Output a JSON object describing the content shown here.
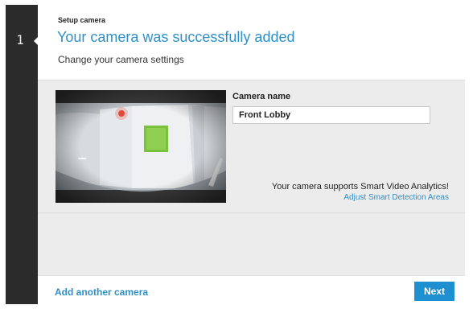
{
  "stepper": {
    "number": "1"
  },
  "header": {
    "setup_label": "Setup camera",
    "title": "Your camera was successfully added",
    "subtitle": "Change your camera settings"
  },
  "camera": {
    "name_label": "Camera name",
    "name_value": "Front Lobby",
    "analytics_text": "Your camera supports Smart Video Analytics!",
    "adjust_link": "Adjust Smart Detection Areas"
  },
  "footer": {
    "add_camera_label": "Add another camera",
    "next_label": "Next"
  },
  "colors": {
    "accent": "#2f8fc7",
    "button": "#1e8fd0",
    "rail": "#2b2b2b",
    "panel": "#ececec"
  }
}
